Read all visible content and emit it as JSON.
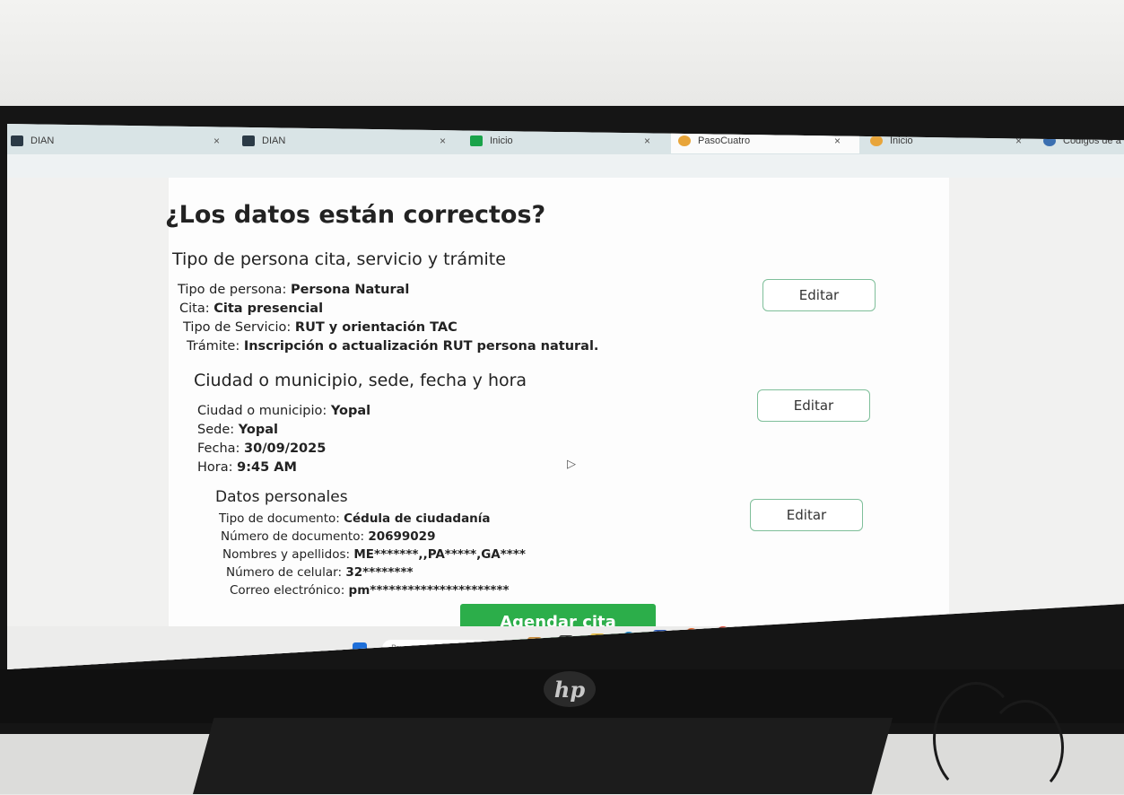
{
  "browser": {
    "tabs": [
      {
        "label": "DIAN",
        "icon": "dian-icon"
      },
      {
        "label": "DIAN",
        "icon": "dian-icon"
      },
      {
        "label": "Inicio",
        "icon": "green-page-icon"
      },
      {
        "label": "PasoCuatro",
        "icon": "orange-page-icon"
      },
      {
        "label": "Inicio",
        "icon": "orange-page-icon"
      },
      {
        "label": "Códigos de a",
        "icon": "globe-icon"
      }
    ],
    "close_glyph": "×"
  },
  "page": {
    "title": "¿Los datos están correctos?",
    "edit_label": "Editar",
    "sections": [
      {
        "heading": "Tipo de persona cita, servicio y trámite",
        "rows": [
          {
            "label": "Tipo de persona:",
            "value": "Persona Natural"
          },
          {
            "label": "Cita:",
            "value": "Cita presencial"
          },
          {
            "label": "Tipo de Servicio:",
            "value": "RUT y orientación TAC"
          },
          {
            "label": "Trámite:",
            "value": "Inscripción o actualización RUT persona natural."
          }
        ]
      },
      {
        "heading": "Ciudad o municipio, sede, fecha y hora",
        "rows": [
          {
            "label": "Ciudad o municipio:",
            "value": "Yopal"
          },
          {
            "label": "Sede:",
            "value": "Yopal"
          },
          {
            "label": "Fecha:",
            "value": "30/09/2025"
          },
          {
            "label": "Hora:",
            "value": "9:45 AM"
          }
        ]
      },
      {
        "heading": "Datos personales",
        "rows": [
          {
            "label": "Tipo de documento:",
            "value": "Cédula de ciudadanía"
          },
          {
            "label": "Número de documento:",
            "value": "20699029"
          },
          {
            "label": "Nombres y apellidos:",
            "value": "ME*******,,PA*****,GA****"
          },
          {
            "label": "Número de celular:",
            "value": "32********"
          },
          {
            "label": "Correo electrónico:",
            "value": "pm**********************"
          }
        ]
      }
    ],
    "submit_label": "Agendar cita"
  },
  "taskbar": {
    "search_placeholder": "Buscar"
  },
  "colors": {
    "accent_green": "#2cae4a",
    "button_border": "#7fbf9a"
  }
}
